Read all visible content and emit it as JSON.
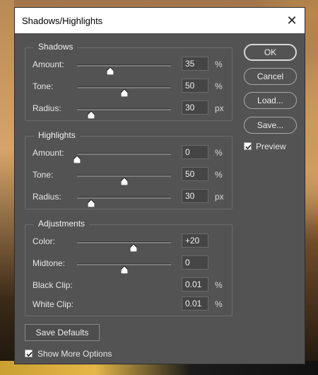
{
  "window": {
    "title": "Shadows/Highlights",
    "close_symbol": "✕"
  },
  "shadows": {
    "legend": "Shadows",
    "amount": {
      "label": "Amount:",
      "value": "35",
      "unit": "%",
      "level": 0.35
    },
    "tone": {
      "label": "Tone:",
      "value": "50",
      "unit": "%",
      "level": 0.5
    },
    "radius": {
      "label": "Radius:",
      "value": "30",
      "unit": "px",
      "level": 0.15
    }
  },
  "highlights": {
    "legend": "Highlights",
    "amount": {
      "label": "Amount:",
      "value": "0",
      "unit": "%",
      "level": 0.0
    },
    "tone": {
      "label": "Tone:",
      "value": "50",
      "unit": "%",
      "level": 0.5
    },
    "radius": {
      "label": "Radius:",
      "value": "30",
      "unit": "px",
      "level": 0.15
    }
  },
  "adjustments": {
    "legend": "Adjustments",
    "color": {
      "label": "Color:",
      "value": "+20",
      "level": 0.6
    },
    "midtone": {
      "label": "Midtone:",
      "value": "0",
      "level": 0.5
    },
    "black_clip": {
      "label": "Black Clip:",
      "value": "0.01",
      "unit": "%"
    },
    "white_clip": {
      "label": "White Clip:",
      "value": "0.01",
      "unit": "%"
    }
  },
  "buttons": {
    "ok": "OK",
    "cancel": "Cancel",
    "load": "Load...",
    "save": "Save...",
    "save_defaults": "Save Defaults"
  },
  "preview": {
    "label": "Preview",
    "checked": true
  },
  "show_more": {
    "label": "Show More Options",
    "checked": true
  },
  "colors": {
    "dialog_bg": "#535353",
    "field_bg": "#454545",
    "text": "#e6e6e6"
  }
}
